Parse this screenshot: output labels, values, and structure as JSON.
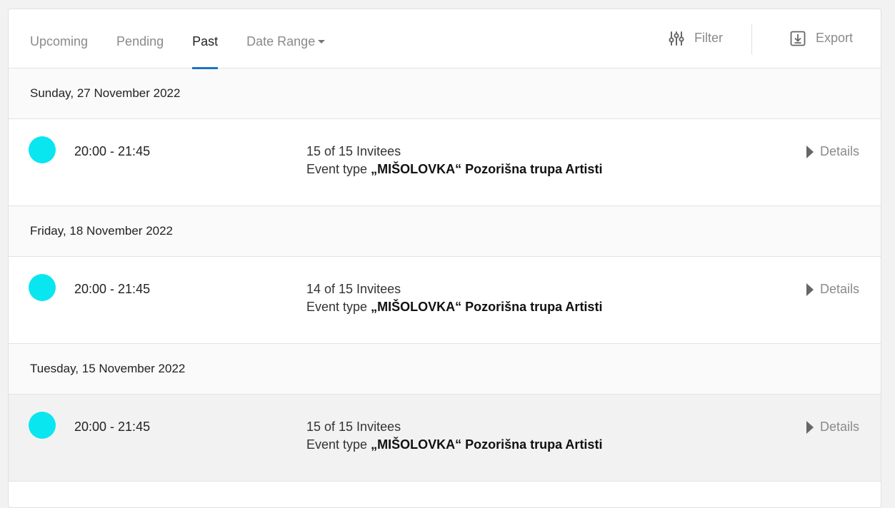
{
  "tabs": [
    {
      "label": "Upcoming"
    },
    {
      "label": "Pending"
    },
    {
      "label": "Past"
    },
    {
      "label": "Date Range"
    }
  ],
  "active_tab": "Past",
  "actions": {
    "filter_label": "Filter",
    "export_label": "Export"
  },
  "colors": {
    "accent": "#1a73c9",
    "event_dot": "#0ae6f0"
  },
  "groups": [
    {
      "date": "Sunday, 27 November 2022",
      "event": {
        "time": "20:00 - 21:45",
        "invitees": "15 of 15 Invitees",
        "event_type_prefix": "Event type",
        "event_type_name": "„MIŠOLOVKA“ Pozorišna trupa Artisti",
        "details_label": "Details"
      }
    },
    {
      "date": "Friday, 18 November 2022",
      "event": {
        "time": "20:00 - 21:45",
        "invitees": "14 of 15 Invitees",
        "event_type_prefix": "Event type",
        "event_type_name": "„MIŠOLOVKA“ Pozorišna trupa Artisti",
        "details_label": "Details"
      }
    },
    {
      "date": "Tuesday, 15 November 2022",
      "event": {
        "time": "20:00 - 21:45",
        "invitees": "15 of 15 Invitees",
        "event_type_prefix": "Event type",
        "event_type_name": "„MIŠOLOVKA“ Pozorišna trupa Artisti",
        "details_label": "Details"
      }
    }
  ]
}
